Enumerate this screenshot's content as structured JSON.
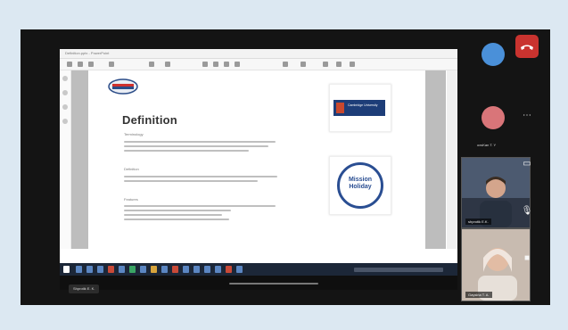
{
  "meeting": {
    "self_name": "Shprotik E. K.",
    "participants": [
      {
        "label": "",
        "color": "#4a90d9"
      },
      {
        "label": "oxsKan T. Y",
        "color": "#d97579"
      }
    ],
    "video_tiles": [
      {
        "label": "shprotik E.K."
      },
      {
        "label": "Gaysina T. A."
      }
    ]
  },
  "shared_screen": {
    "window_title": "Definition.pptx - PowerPoint",
    "slide": {
      "title": "Definition",
      "sections": [
        "Terminology",
        "Definition",
        "Features"
      ]
    },
    "logos": [
      {
        "text": "Cambridge University"
      },
      {
        "text": "Mission Holiday"
      }
    ]
  },
  "controls": [
    {
      "icon": "phone-hangup-icon"
    },
    {
      "icon": "more-icon"
    },
    {
      "icon": "share-screen-icon"
    },
    {
      "icon": "mic-off-icon"
    },
    {
      "icon": "camera-icon"
    }
  ],
  "colors": {
    "accent_red": "#c9332f",
    "page_bg": "#dce8f2"
  }
}
